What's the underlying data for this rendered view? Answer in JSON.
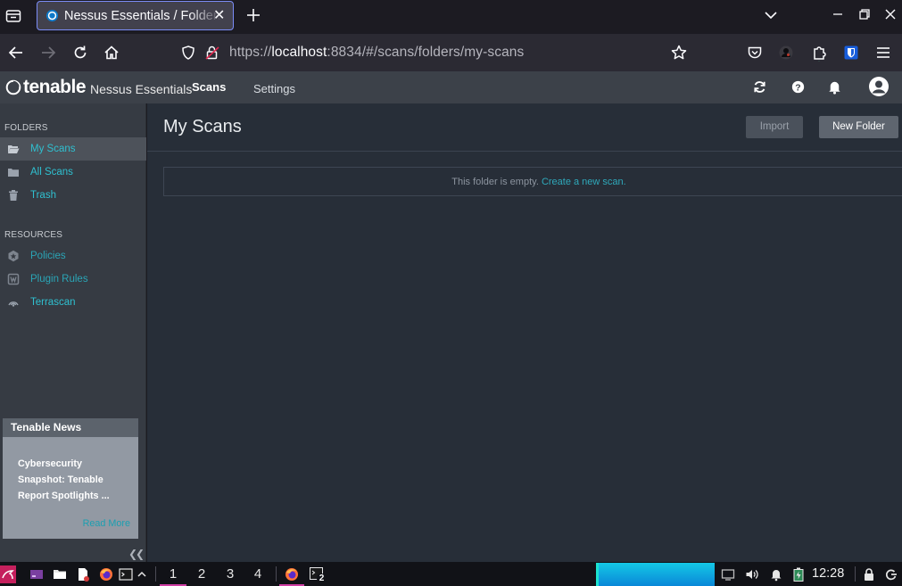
{
  "browser": {
    "tab_title": "Nessus Essentials / Folders / My Scans",
    "url_prefix": "https://",
    "url_host": "localhost",
    "url_rest": ":8834/#/scans/folders/my-scans"
  },
  "header": {
    "brand": "tenable",
    "product": "Nessus Essentials",
    "nav": [
      {
        "label": "Scans",
        "active": true
      },
      {
        "label": "Settings",
        "active": false
      }
    ]
  },
  "sidebar": {
    "folders_heading": "FOLDERS",
    "folders": [
      {
        "label": "My Scans",
        "icon": "folder-open-icon",
        "selected": true
      },
      {
        "label": "All Scans",
        "icon": "folder-icon",
        "selected": false
      },
      {
        "label": "Trash",
        "icon": "trash-icon",
        "selected": false
      }
    ],
    "resources_heading": "RESOURCES",
    "resources": [
      {
        "label": "Policies",
        "icon": "policy-icon"
      },
      {
        "label": "Plugin Rules",
        "icon": "plugin-rules-icon"
      },
      {
        "label": "Terrascan",
        "icon": "terrascan-icon"
      }
    ],
    "news": {
      "title": "Tenable News",
      "headline": "Cybersecurity Snapshot: Tenable Report Spotlights ...",
      "read_more": "Read More"
    }
  },
  "main": {
    "title": "My Scans",
    "import_label": "Import",
    "new_folder_label": "New Folder",
    "empty_text": "This folder is empty.",
    "empty_link": "Create a new scan."
  },
  "taskbar": {
    "workspaces": [
      "1",
      "2",
      "3",
      "4"
    ],
    "active_workspace": "1",
    "terminal_badge": "2",
    "clock": "12:28"
  },
  "colors": {
    "accent_link": "#2fc0d0",
    "app_header": "#3c4149",
    "sidebar": "#363b43",
    "content": "#272e38",
    "workspace_indicator": "#d03fa5"
  }
}
